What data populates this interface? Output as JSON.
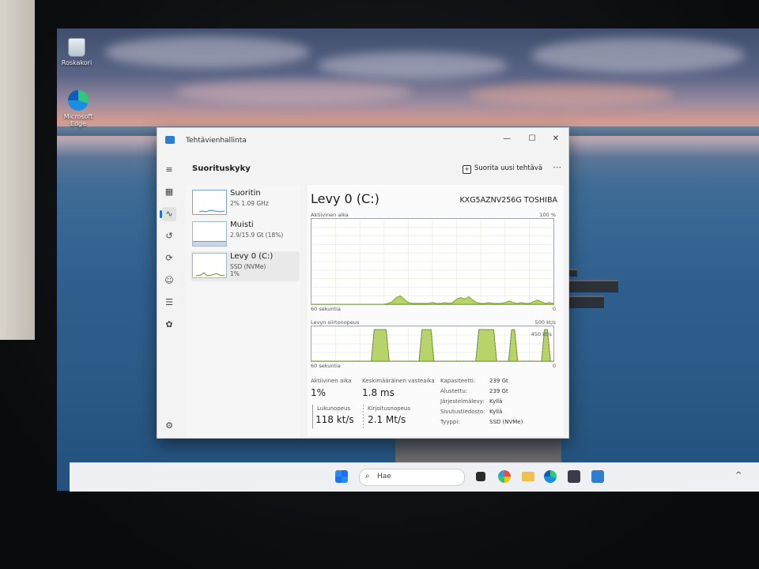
{
  "desktop": {
    "recycle_bin_label": "Roskakori",
    "edge_label_line1": "Microsoft",
    "edge_label_line2": "Edge"
  },
  "window": {
    "title": "Tehtävienhallinta",
    "page_title": "Suorituskyky",
    "run_new_task": "Suorita uusi tehtävä",
    "more": "⋯"
  },
  "sidebar": {
    "items": [
      {
        "name": "Suoritin",
        "sub": "2% 1.09 GHz",
        "sub2": ""
      },
      {
        "name": "Muisti",
        "sub": "2.9/15.9 Gt (18%)",
        "sub2": ""
      },
      {
        "name": "Levy 0 (C:)",
        "sub": "SSD (NVMe)",
        "sub2": "1%"
      }
    ]
  },
  "disk": {
    "title": "Levy 0 (C:)",
    "model": "KXG5AZNV256G TOSHIBA",
    "chart1": {
      "label": "Aktiivinen aika",
      "max": "100 %",
      "left_bottom": "60 sekuntia",
      "right_bottom": "0",
      "values": [
        0,
        0,
        0,
        0,
        0,
        0,
        0,
        0,
        0,
        0,
        0,
        0,
        0,
        0,
        0,
        0,
        0,
        0,
        0,
        1,
        3,
        8,
        10,
        6,
        2,
        1,
        1,
        1,
        1,
        1,
        2,
        1,
        1,
        2,
        1,
        2,
        6,
        8,
        6,
        9,
        5,
        2,
        1,
        1,
        2,
        1,
        1,
        1,
        2,
        4,
        2,
        1,
        2,
        1,
        1,
        3,
        5,
        3,
        1,
        2,
        1
      ]
    },
    "chart2": {
      "label": "Levyn siirtonopeus",
      "max": "500 kt/s",
      "inner_label": "450 kt/s",
      "left_bottom": "60 sekuntia",
      "right_bottom": "0",
      "values": [
        0,
        0,
        0,
        0,
        0,
        0,
        0,
        0,
        0,
        0,
        0,
        0,
        0,
        0,
        0,
        0,
        0,
        0,
        0,
        0,
        0,
        95,
        95,
        95,
        95,
        95,
        0,
        0,
        0,
        0,
        0,
        0,
        0,
        0,
        0,
        0,
        0,
        95,
        95,
        95,
        95,
        0,
        0,
        0,
        0,
        0,
        0,
        0,
        0,
        0,
        0,
        0,
        0,
        0,
        0,
        0,
        95,
        95,
        95,
        95,
        95,
        95,
        0,
        0,
        0,
        0,
        0,
        95,
        95,
        0,
        0,
        0,
        0,
        0,
        0,
        0,
        0,
        0,
        95,
        95,
        0,
        0
      ]
    },
    "stats": {
      "active_time_label": "Aktiivinen aika",
      "active_time_value": "1%",
      "response_label": "Keskimääräinen vasteaika",
      "response_value": "1.8 ms",
      "read_label": "Lukunopeus",
      "read_value": "118 kt/s",
      "write_label": "Kirjoitusnopeus",
      "write_value": "2.1 Mt/s"
    },
    "props": [
      {
        "key": "Kapasiteetti:",
        "value": "239 Gt"
      },
      {
        "key": "Alustettu:",
        "value": "239 Gt"
      },
      {
        "key": "Järjestelmälevy:",
        "value": "Kyllä"
      },
      {
        "key": "Sivutustiedosto:",
        "value": "Kyllä"
      },
      {
        "key": "Tyyppi:",
        "value": "SSD (NVMe)"
      }
    ]
  },
  "taskbar": {
    "search_placeholder": "Hae",
    "tray_chevron": "^"
  },
  "colors": {
    "accent": "#1f6fcf",
    "disk_fill": "#b7d46a",
    "disk_line": "#7ea42c"
  }
}
